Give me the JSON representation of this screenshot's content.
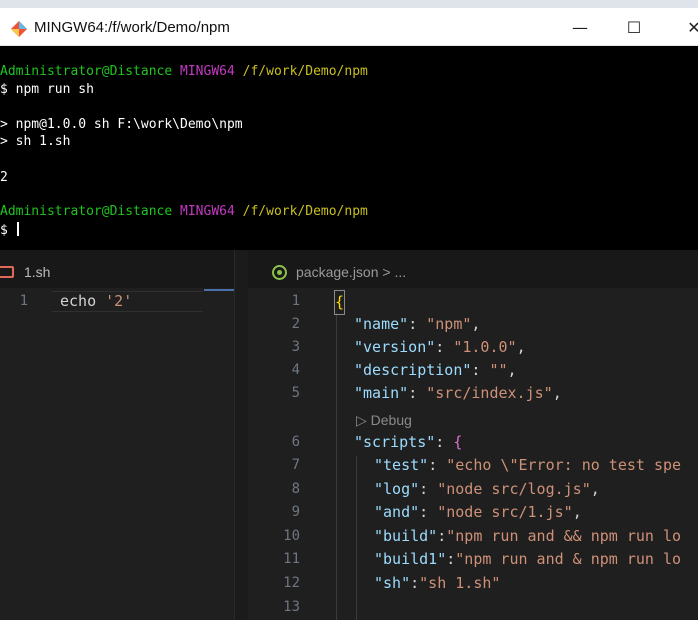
{
  "window": {
    "title": "MINGW64:/f/work/Demo/npm",
    "minimize_glyph": "—",
    "maximize_glyph": "☐",
    "close_glyph": "✕"
  },
  "terminal": {
    "prompt_user": "Administrator@Distance",
    "prompt_env": "MINGW64",
    "prompt_path": "/f/work/Demo/npm",
    "command": "$ npm run sh",
    "script_header_1": "> npm@1.0.0 sh F:\\work\\Demo\\npm",
    "script_header_2": "> sh 1.sh",
    "output": "2",
    "prompt_symbol": "$ "
  },
  "left_editor": {
    "tab_label": "1.sh",
    "line_numbers": [
      "1"
    ],
    "line_1_cmd": "echo ",
    "line_1_arg": "'2'"
  },
  "right_editor": {
    "tab_label": "package.json",
    "breadcrumb_suffix": " > ...",
    "line_numbers": [
      "1",
      "2",
      "3",
      "4",
      "5",
      "6",
      "7",
      "8",
      "9",
      "10",
      "11",
      "12",
      "13"
    ],
    "codelens": "▷ Debug",
    "open_brace": "{",
    "name_key": "\"name\"",
    "name_val": "\"npm\"",
    "version_key": "\"version\"",
    "version_val": "\"1.0.0\"",
    "description_key": "\"description\"",
    "description_val": "\"\"",
    "main_key": "\"main\"",
    "main_val": "\"src/index.js\"",
    "scripts_key": "\"scripts\"",
    "scripts_open": "{",
    "test_key": "\"test\"",
    "test_val": "\"echo \\\"Error: no test spe",
    "log_key": "\"log\"",
    "log_val": "\"node src/log.js\"",
    "and_key": "\"and\"",
    "and_val": "\"node src/1.js\"",
    "build_key": "\"build\"",
    "build_val": "\"npm run and && npm run lo",
    "build1_key": "\"build1\"",
    "build1_val": "\"npm run and & npm run lo",
    "sh_key": "\"sh\"",
    "sh_val": "\"sh 1.sh\""
  },
  "colors": {
    "terminal_bg": "#000000",
    "prompt_green": "#1ec51e",
    "prompt_magenta": "#c339c3",
    "prompt_yellow": "#c8c020",
    "editor_bg": "#1f1f1f",
    "json_key": "#9cdcfe",
    "json_string": "#ce9178"
  },
  "icons": {
    "app": "git-bash-icon",
    "sh_file": "shell-file-icon",
    "json_file": "json-file-icon"
  }
}
